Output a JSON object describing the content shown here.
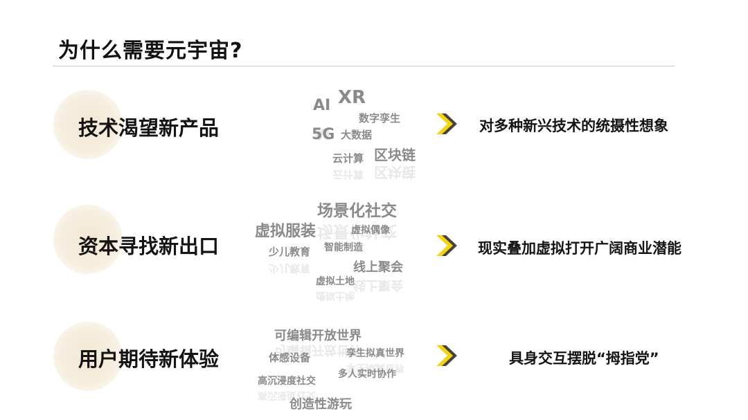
{
  "title": "为什么需要元宇宙?",
  "rows": [
    {
      "heading": "技术渴望新产品",
      "result": "对多种新兴技术的统摄性想象",
      "keywords": [
        "AI",
        "XR",
        "数字孪生",
        "5G",
        "大数据",
        "云计算",
        "区块链"
      ]
    },
    {
      "heading": "资本寻找新出口",
      "result": "现实叠加虚拟打开广阔商业潜能",
      "keywords": [
        "场景化社交",
        "虚拟服装",
        "虚拟偶像",
        "少儿教育",
        "智能制造",
        "线上聚会",
        "虚拟土地"
      ]
    },
    {
      "heading": "用户期待新体验",
      "result": "具身交互摆脱“拇指党”",
      "keywords": [
        "可编辑开放世界",
        "体感设备",
        "孪生拟真世界",
        "高沉浸度社交",
        "多人实时协作",
        "创造性游玩"
      ]
    }
  ],
  "colors": {
    "arrow": "#f2d31b",
    "arrow_dark": "#2a2a2a",
    "keyword": "#8a8a8a"
  }
}
